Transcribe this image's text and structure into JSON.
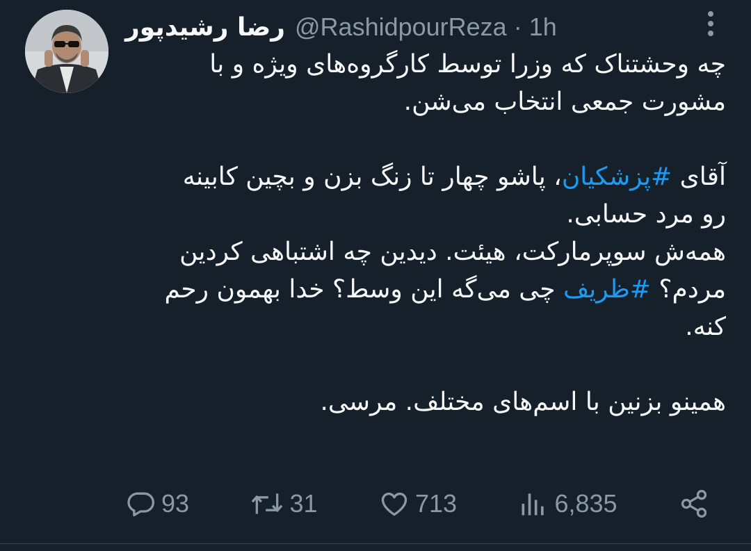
{
  "tweet": {
    "display_name": "رضا رشیدپور",
    "handle": "@RashidpourReza",
    "separator": "·",
    "time": "1h",
    "avatar_icon": "profile-photo",
    "lines": [
      {
        "text": "چه وحشتناک که وزرا توسط کارگروه‌های ویژه و با"
      },
      {
        "text": "مشورت جمعی انتخاب می‌شن."
      },
      {
        "text": ""
      },
      {
        "before": "آقای ",
        "hashtag": "#پزشکیان",
        "after": "، پاشو چهار تا زنگ بزن و بچین کابینه"
      },
      {
        "text": "رو مرد حسابی."
      },
      {
        "text": "همه‌ش سوپرمارکت، هیئت. دیدین چه اشتباهی کردین"
      },
      {
        "before": "مردم؟ ",
        "hashtag": "#ظریف",
        "after": " چی می‌گه این وسط؟ خدا بهمون رحم"
      },
      {
        "text": "کنه."
      },
      {
        "text": ""
      },
      {
        "text": "همینو بزنین با اسم‌های مختلف. مرسی."
      }
    ],
    "hashtag_color": "#1d9bf0",
    "stats": {
      "replies": "93",
      "retweets": "31",
      "likes": "713",
      "views": "6,835"
    },
    "icons": {
      "reply": "reply-icon",
      "retweet": "retweet-icon",
      "like": "heart-icon",
      "views": "views-icon",
      "share": "share-icon",
      "more": "more-vertical-icon"
    },
    "colors": {
      "background": "#15202b",
      "text": "#f7f9f9",
      "muted": "#8b98a5"
    }
  }
}
